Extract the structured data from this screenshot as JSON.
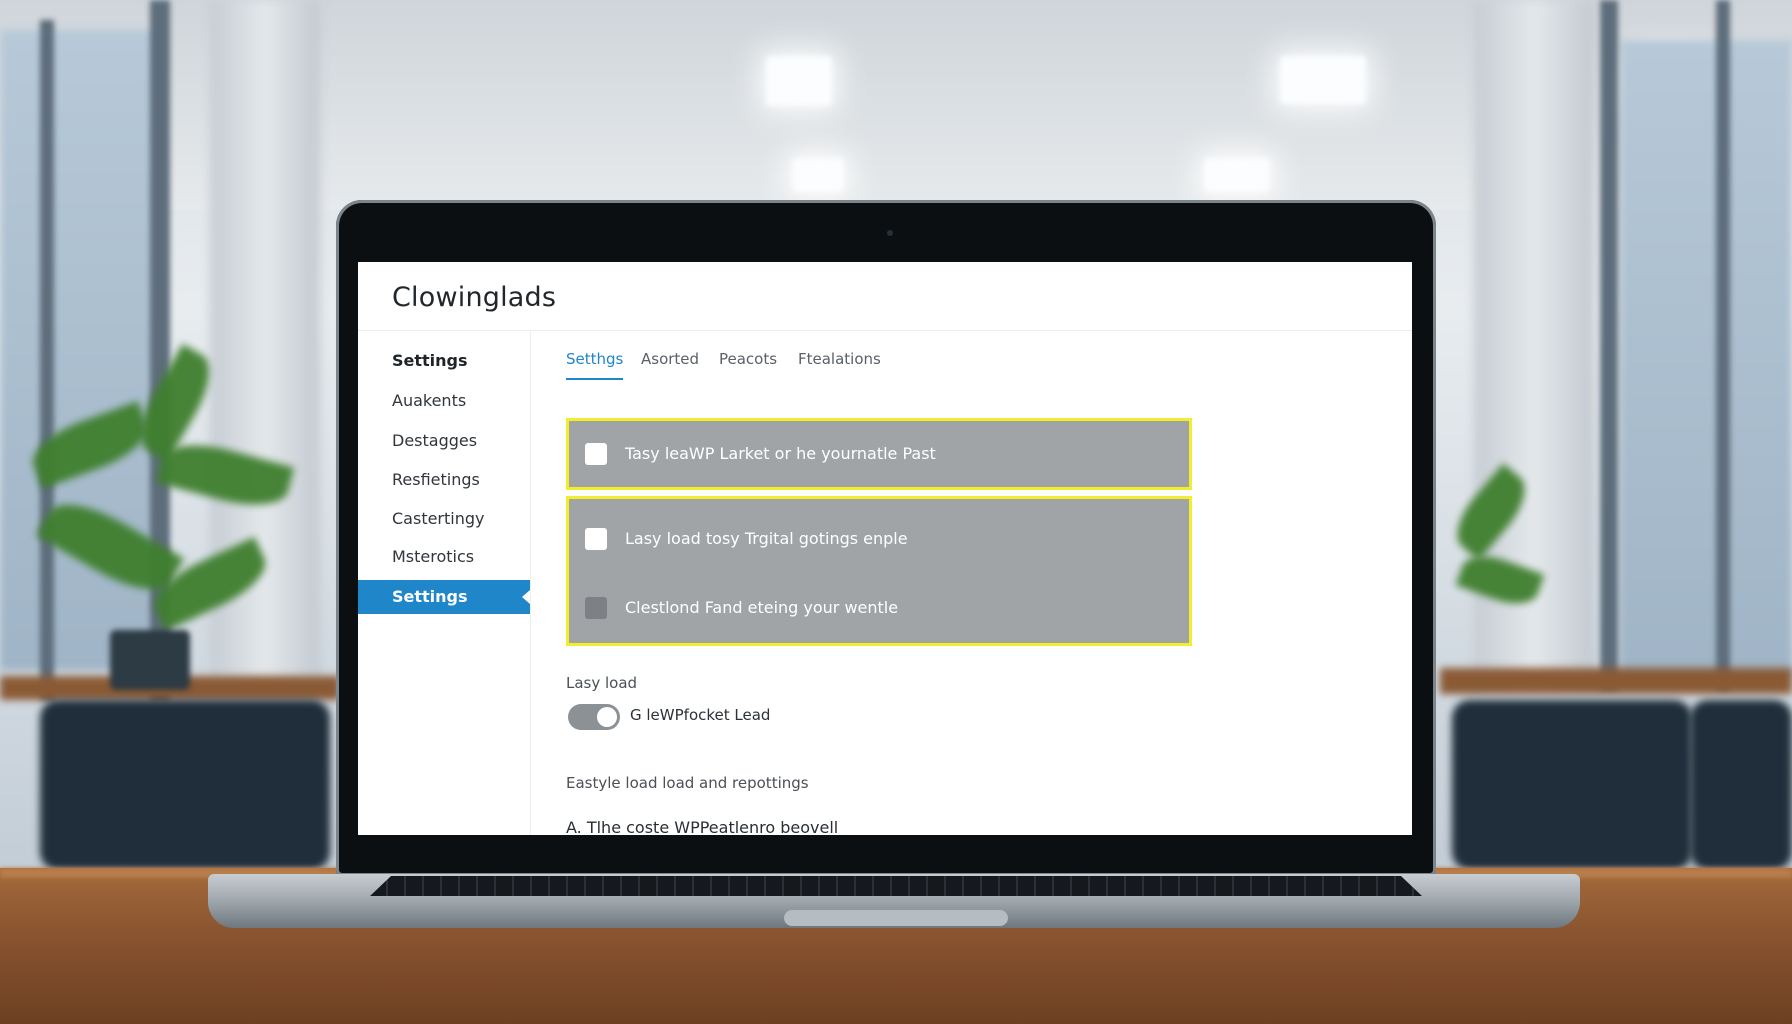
{
  "app": {
    "title": "Clowinglads"
  },
  "sidebar": {
    "items": [
      {
        "label": "Settings",
        "state": "bold"
      },
      {
        "label": "Auakents",
        "state": "normal"
      },
      {
        "label": "Destagges",
        "state": "normal"
      },
      {
        "label": "Resfietings",
        "state": "normal"
      },
      {
        "label": "Castertingy",
        "state": "normal"
      },
      {
        "label": "Msterotics",
        "state": "normal"
      },
      {
        "label": "Settings",
        "state": "active"
      }
    ]
  },
  "tabs": [
    {
      "label": "Setthgs",
      "active": true
    },
    {
      "label": "Asorted",
      "active": false
    },
    {
      "label": "Peacots",
      "active": false
    },
    {
      "label": "Ftealations",
      "active": false
    }
  ],
  "options": {
    "highlight_color": "#f2ee2b",
    "panel_color": "#a0a4a7",
    "items": [
      {
        "label": "Tasy leaWP Larket or he yournatle Past",
        "checked": false
      },
      {
        "label": "Lasy load tosy Trgital gotings enple",
        "checked": false
      },
      {
        "label": "Clestlond Fand eteing your wentle",
        "checked": false,
        "disabled": true
      }
    ]
  },
  "lazy_load": {
    "section_label": "Lasy load",
    "toggle_label": "G leWPfocket Lead",
    "toggle_on": true
  },
  "subheading": "Eastyle load load and repottings",
  "footer_line": "A. Tlhe coste WPPeatlenro beovell",
  "colors": {
    "accent": "#1f86c9",
    "screen_bg": "#ffffff"
  }
}
